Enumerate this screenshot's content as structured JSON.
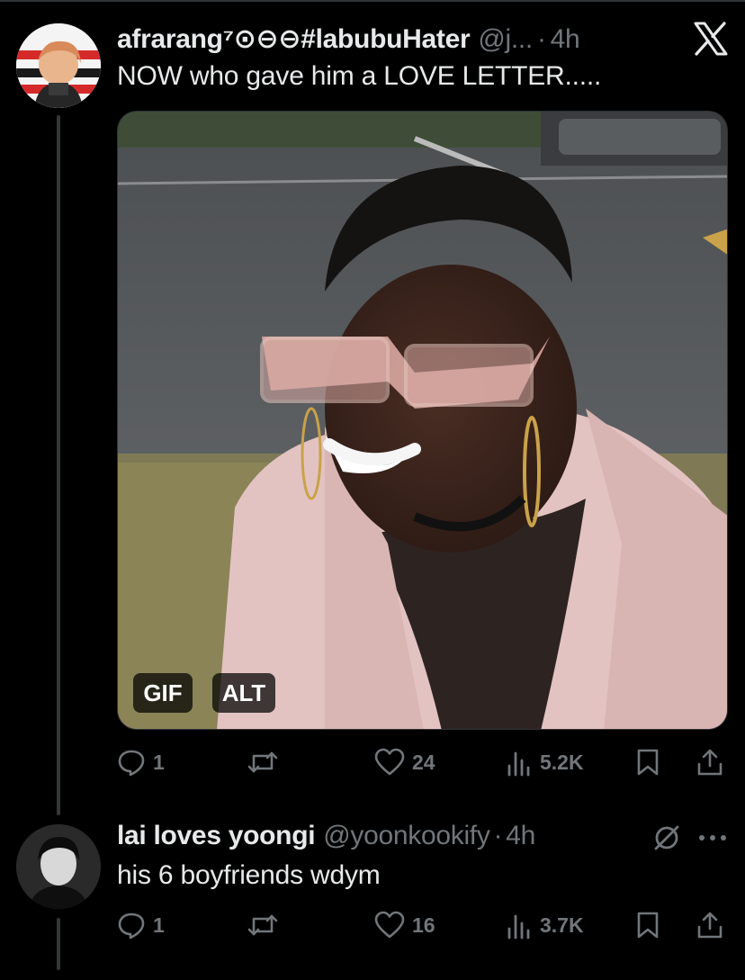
{
  "posts": [
    {
      "display_name": "afrarang⁷⊙⊖⊖#labubuHater",
      "handle": "@j...",
      "separator": "·",
      "time": "4h",
      "text": "NOW who gave him a LOVE LETTER.....",
      "media_badges": [
        "GIF",
        "ALT"
      ],
      "metrics": {
        "replies": "1",
        "likes": "24",
        "views": "5.2K"
      }
    },
    {
      "display_name": "lai loves yoongi",
      "handle": "@yoonkookify",
      "separator": "·",
      "time": "4h",
      "text": "his 6 boyfriends wdym",
      "metrics": {
        "replies": "1",
        "likes": "16",
        "views": "3.7K"
      }
    }
  ],
  "icons": {
    "platform": "x-logo-icon",
    "reply": "reply-icon",
    "repost": "repost-icon",
    "like": "heart-icon",
    "views": "views-icon",
    "bookmark": "bookmark-icon",
    "share": "share-icon",
    "mute": "mute-icon",
    "more": "more-icon"
  },
  "colors": {
    "background": "#000000",
    "primary_text": "#e7e9ea",
    "secondary_text": "#71767b",
    "divider": "#2f3336"
  }
}
